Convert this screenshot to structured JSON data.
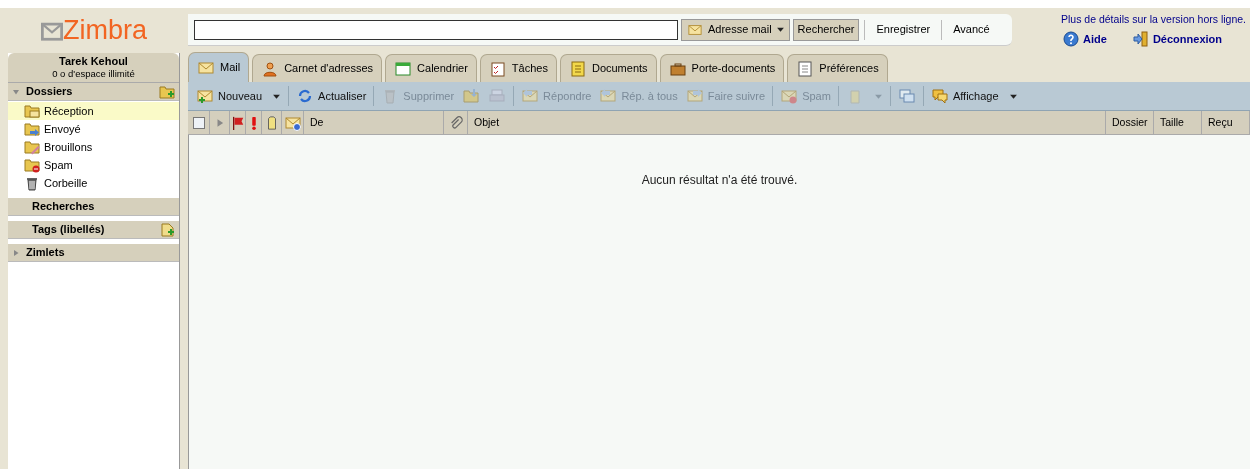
{
  "logo": "Zimbra",
  "account": {
    "name": "Tarek Kehoul",
    "quota": "0 o d'espace illimité"
  },
  "sidebar": {
    "sections": [
      {
        "title": "Dossiers",
        "expanded": true,
        "items": [
          {
            "label": "Réception",
            "selected": true
          },
          {
            "label": "Envoyé",
            "selected": false
          },
          {
            "label": "Brouillons",
            "selected": false
          },
          {
            "label": "Spam",
            "selected": false
          },
          {
            "label": "Corbeille",
            "selected": false
          }
        ]
      },
      {
        "title": "Recherches"
      },
      {
        "title": "Tags (libellés)"
      },
      {
        "title": "Zimlets",
        "expanded": false
      }
    ]
  },
  "search": {
    "scope": "Adresse mail",
    "buttons": [
      "Rechercher",
      "Enregistrer",
      "Avancé"
    ]
  },
  "offline_link": "Plus de détails sur la version hors ligne.",
  "links": [
    "Aide",
    "Déconnexion"
  ],
  "tabs": [
    {
      "label": "Mail",
      "selected": true
    },
    {
      "label": "Carnet d'adresses",
      "selected": false
    },
    {
      "label": "Calendrier",
      "selected": false
    },
    {
      "label": "Tâches",
      "selected": false
    },
    {
      "label": "Documents",
      "selected": false
    },
    {
      "label": "Porte-documents",
      "selected": false
    },
    {
      "label": "Préférences",
      "selected": false
    }
  ],
  "toolbar": [
    {
      "label": "Nouveau",
      "disabled": false,
      "menu": true
    },
    {
      "label": "Actualiser",
      "disabled": false,
      "menu": false
    },
    {
      "label": "Supprimer",
      "disabled": true,
      "menu": false
    },
    {
      "disabled": true,
      "menu": false
    },
    {
      "disabled": true,
      "menu": false
    },
    {
      "label": "Répondre",
      "disabled": true,
      "menu": false
    },
    {
      "label": "Rép. à tous",
      "disabled": true,
      "menu": false
    },
    {
      "label": "Faire suivre",
      "disabled": true,
      "menu": false
    },
    {
      "label": "Spam",
      "disabled": true,
      "menu": false
    },
    {
      "disabled": true,
      "menu": true
    },
    {
      "disabled": false,
      "menu": false
    },
    {
      "label": "Affichage",
      "disabled": false,
      "menu": true
    }
  ],
  "table": {
    "select_all_checked": false,
    "columns": [
      "De",
      "Objet",
      "Dossier",
      "Taille",
      "Reçu"
    ],
    "empty_message": "Aucun résultat n'a été trouvé."
  }
}
